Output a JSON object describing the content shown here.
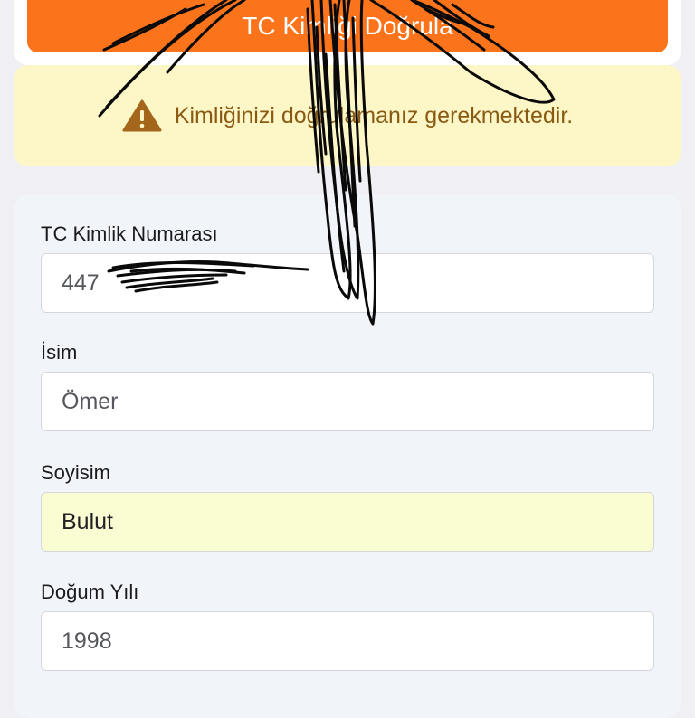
{
  "header": {
    "verify_button_label": "TC Kimliği Doğrula"
  },
  "warning": {
    "text": "Kimliğinizi doğrulamanız gerekmektedir."
  },
  "form": {
    "fields": [
      {
        "label": "TC Kimlik Numarası",
        "value": "447"
      },
      {
        "label": "İsim",
        "value": "Ömer"
      },
      {
        "label": "Soyisim",
        "value": "Bulut"
      },
      {
        "label": "Doğum Yılı",
        "value": "1998"
      }
    ]
  },
  "colors": {
    "accent": "#fb741c",
    "warning_bg": "#fdf6c7",
    "warning_text": "#8a5a12",
    "autofill_bg": "#fafcd2"
  },
  "icons": {
    "warning": "warning-triangle-icon"
  }
}
